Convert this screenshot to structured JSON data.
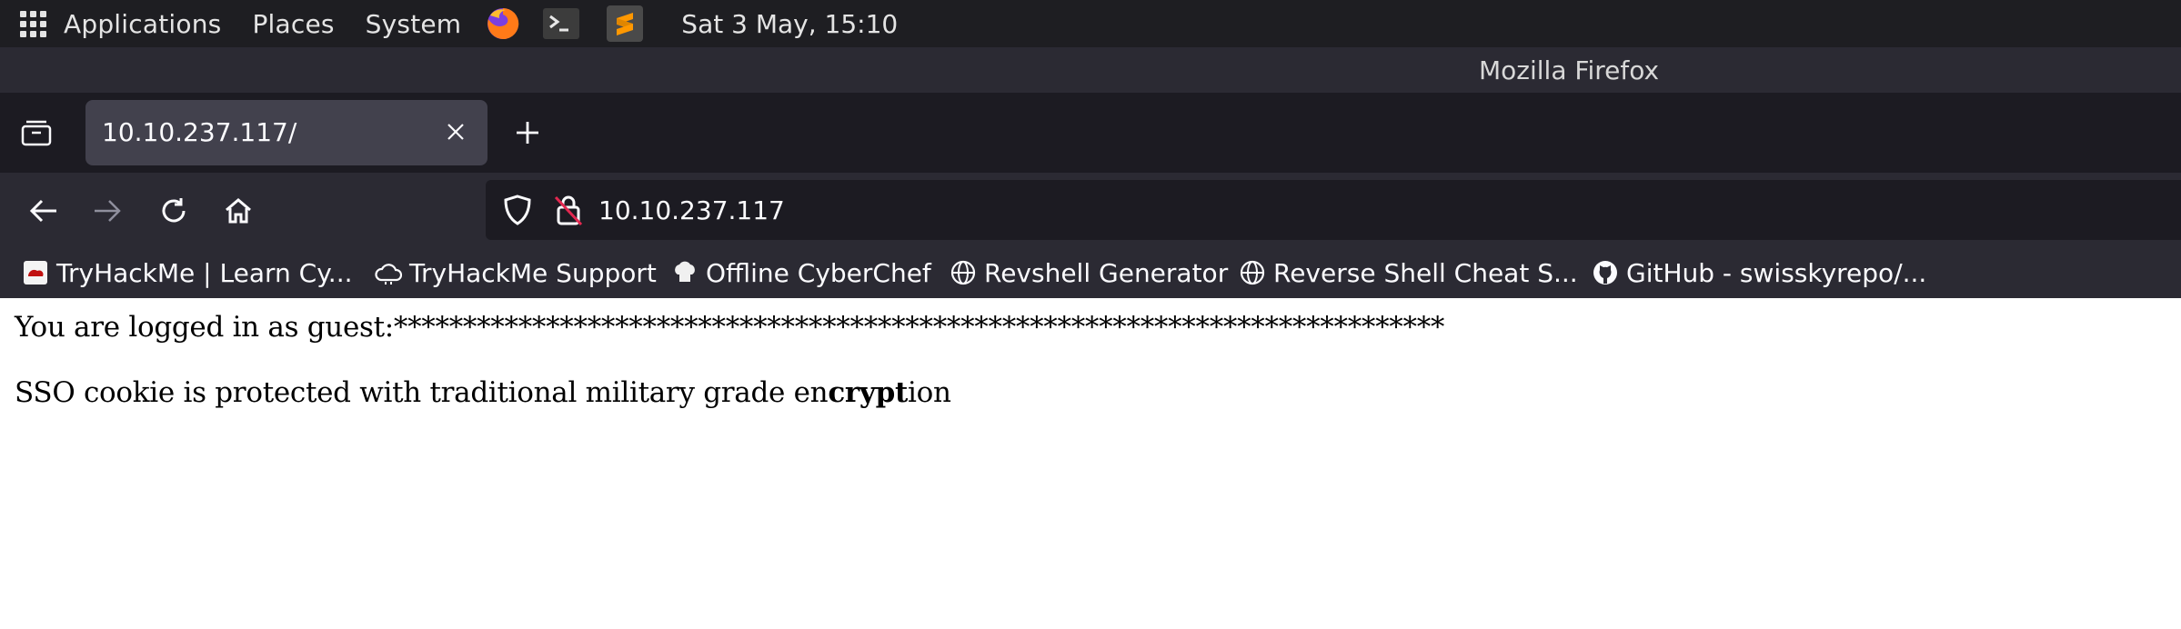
{
  "top_panel": {
    "menus": [
      "Applications",
      "Places",
      "System"
    ],
    "icons": [
      "apps-grid-icon",
      "firefox-icon",
      "terminal-icon",
      "sublime-text-icon"
    ],
    "clock": "Sat  3 May, 15:10"
  },
  "window": {
    "title": "Mozilla Firefox"
  },
  "tabs": [
    {
      "title": "10.10.237.117/",
      "active": true
    }
  ],
  "navbar": {
    "url": "10.10.237.117"
  },
  "bookmarks": [
    {
      "label": "TryHackMe | Learn Cy...",
      "icon": "tryhackme-icon"
    },
    {
      "label": "TryHackMe Support",
      "icon": "cloud-icon"
    },
    {
      "label": "Offline CyberChef",
      "icon": "chef-hat-icon"
    },
    {
      "label": "Revshell Generator",
      "icon": "globe-icon"
    },
    {
      "label": "Reverse Shell Cheat S...",
      "icon": "globe-icon"
    },
    {
      "label": "GitHub - swisskyrepo/...",
      "icon": "github-icon"
    }
  ],
  "page": {
    "line1": "You are logged in as guest:****************************************************************************",
    "line2_prefix": "SSO cookie is protected with traditional military grade en",
    "line2_bold": "crypt",
    "line2_suffix": "ion"
  },
  "colors": {
    "panel_bg": "#1e1e22",
    "toolbar_bg": "#2b2a33",
    "tabstrip_bg": "#1c1b22",
    "active_tab_bg": "#42414d",
    "text_light": "#fbfbfe"
  }
}
